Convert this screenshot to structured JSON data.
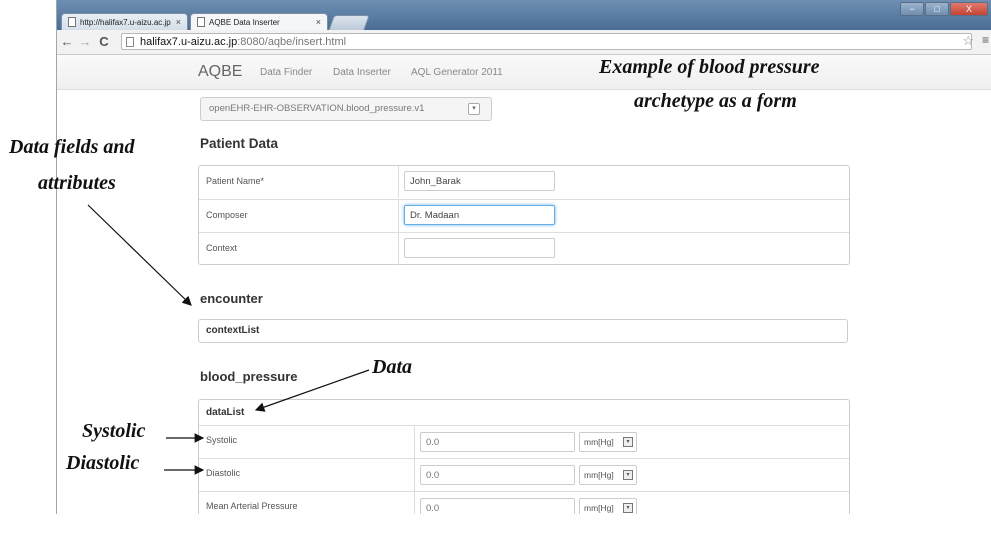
{
  "browser": {
    "tabs": [
      {
        "title": "http://halifax7.u-aizu.ac.jp"
      },
      {
        "title": "AQBE Data Inserter"
      }
    ],
    "url_host": "halifax7.u-aizu.ac.jp",
    "url_path": ":8080/aqbe/insert.html",
    "window_controls": {
      "minimize": "−",
      "maximize": "□",
      "close": "X"
    },
    "icons": {
      "back": "←",
      "forward": "→",
      "reload": "C",
      "star": "☆",
      "menu": "≡",
      "tab_close": "×"
    }
  },
  "nav": {
    "brand": "AQBE",
    "links": [
      "Data Finder",
      "Data Inserter",
      "AQL Generator 2011"
    ]
  },
  "archetype_select": {
    "value": "openEHR-EHR-OBSERVATION.blood_pressure.v1",
    "caret": "▾"
  },
  "patient": {
    "title": "Patient Data",
    "rows": [
      {
        "label": "Patient Name*",
        "value": "John_Barak"
      },
      {
        "label": "Composer",
        "value": "Dr. Madaan"
      },
      {
        "label": "Context",
        "value": ""
      }
    ]
  },
  "encounter": {
    "title": "encounter",
    "context_list": "contextList"
  },
  "blood_pressure": {
    "title": "blood_pressure",
    "data_list": "dataList",
    "rows": [
      {
        "label": "Systolic",
        "placeholder": "0.0",
        "unit": "mm[Hg]"
      },
      {
        "label": "Diastolic",
        "placeholder": "0.0",
        "unit": "mm[Hg]"
      },
      {
        "label": "Mean Arterial Pressure",
        "placeholder": "0.0",
        "unit": "mm[Hg]"
      }
    ]
  },
  "annotations": {
    "example_line1": "Example of blood pressure",
    "example_line2": "archetype as a form",
    "fields_line1": "Data fields and",
    "fields_line2": "attributes",
    "data": "Data",
    "systolic": "Systolic",
    "diastolic": "Diastolic"
  }
}
